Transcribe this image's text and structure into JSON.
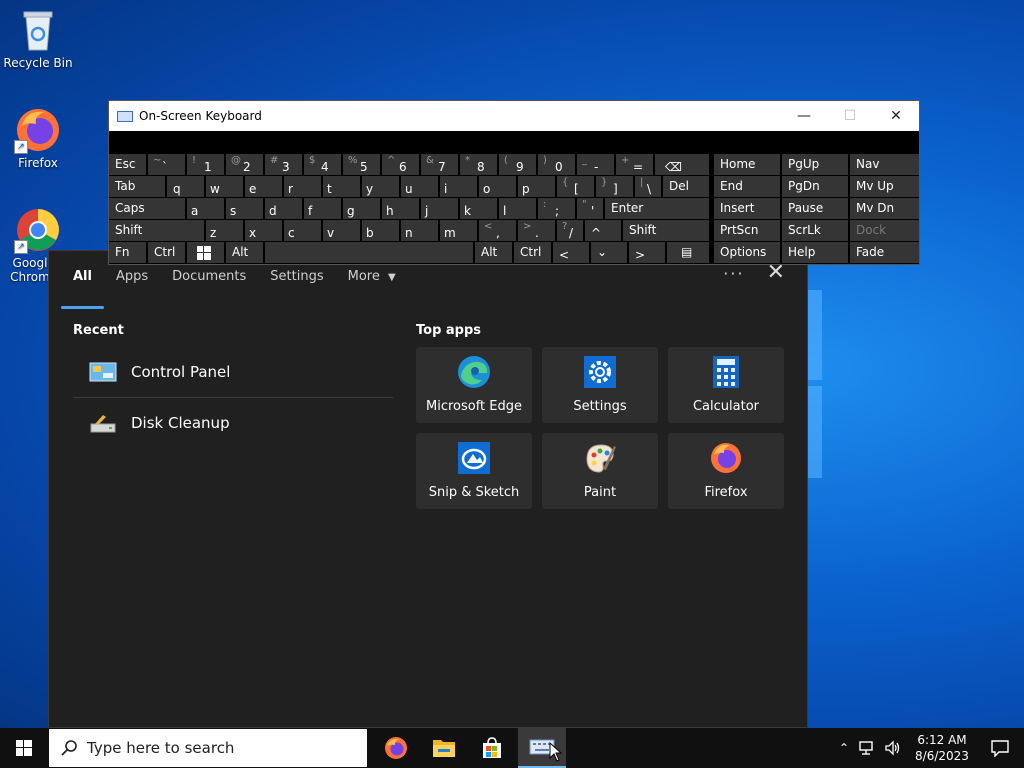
{
  "desktop": {
    "icons": [
      {
        "label": "Recycle Bin"
      },
      {
        "label": "Firefox"
      },
      {
        "label": "Googl Chrom"
      }
    ]
  },
  "osk": {
    "title": "On-Screen Keyboard",
    "minimize": "—",
    "maximize": "☐",
    "close": "✕",
    "keys": {
      "esc": "Esc",
      "tilde_sh": "~",
      "tilde": "`",
      "k1_sh": "!",
      "k1": "1",
      "k2_sh": "@",
      "k2": "2",
      "k3_sh": "#",
      "k3": "3",
      "k4_sh": "$",
      "k4": "4",
      "k5_sh": "%",
      "k5": "5",
      "k6_sh": "^",
      "k6": "6",
      "k7_sh": "&",
      "k7": "7",
      "k8_sh": "*",
      "k8": "8",
      "k9_sh": "(",
      "k9": "9",
      "k0_sh": ")",
      "k0": "0",
      "minus_sh": "_",
      "minus": "-",
      "eq_sh": "+",
      "eq": "=",
      "backspace": "⌫",
      "tab": "Tab",
      "q": "q",
      "w": "w",
      "e": "e",
      "r": "r",
      "t": "t",
      "y": "y",
      "u": "u",
      "i": "i",
      "o": "o",
      "p": "p",
      "lbr_sh": "{",
      "lbr": "[",
      "rbr_sh": "}",
      "rbr": "]",
      "bsl_sh": "|",
      "bsl": "\\",
      "del": "Del",
      "caps": "Caps",
      "a": "a",
      "s": "s",
      "d": "d",
      "f": "f",
      "g": "g",
      "h": "h",
      "j": "j",
      "k": "k",
      "l": "l",
      "semi_sh": ":",
      "semi": ";",
      "quote_sh": "\"",
      "quote": "'",
      "enter": "Enter",
      "shift": "Shift",
      "z": "z",
      "x": "x",
      "c": "c",
      "v": "v",
      "b": "b",
      "n": "n",
      "m": "m",
      "comma_sh": "<",
      "comma": ",",
      "period_sh": ">",
      "period": ".",
      "slash_sh": "?",
      "slash": "/",
      "up": "^",
      "rshift": "Shift",
      "fn": "Fn",
      "ctrl": "Ctrl",
      "alt": "Alt",
      "ralt": "Alt",
      "rctrl": "Ctrl",
      "left": "<",
      "down": "⌄",
      "right": ">",
      "menu": "▤",
      "home": "Home",
      "pgup": "PgUp",
      "nav": "Nav",
      "end": "End",
      "pgdn": "PgDn",
      "mvup": "Mv Up",
      "insert": "Insert",
      "pause": "Pause",
      "mvdn": "Mv Dn",
      "prtscn": "PrtScn",
      "scrlk": "ScrLk",
      "dock": "Dock",
      "options": "Options",
      "help": "Help",
      "fade": "Fade"
    }
  },
  "search_panel": {
    "tabs": [
      {
        "label": "All"
      },
      {
        "label": "Apps"
      },
      {
        "label": "Documents"
      },
      {
        "label": "Settings"
      },
      {
        "label": "More"
      }
    ],
    "more_options": "···",
    "recent_title": "Recent",
    "recent": [
      {
        "label": "Control Panel"
      },
      {
        "label": "Disk Cleanup"
      }
    ],
    "top_apps_title": "Top apps",
    "top_apps": [
      {
        "label": "Microsoft Edge"
      },
      {
        "label": "Settings"
      },
      {
        "label": "Calculator"
      },
      {
        "label": "Snip & Sketch"
      },
      {
        "label": "Paint"
      },
      {
        "label": "Firefox"
      }
    ]
  },
  "taskbar": {
    "search_placeholder": "Type here to search",
    "time": "6:12 AM",
    "date": "8/6/2023"
  },
  "colors": {
    "accent": "#4ca3f5",
    "panel_bg": "#202020",
    "tile_bg": "#2e2e2e"
  }
}
